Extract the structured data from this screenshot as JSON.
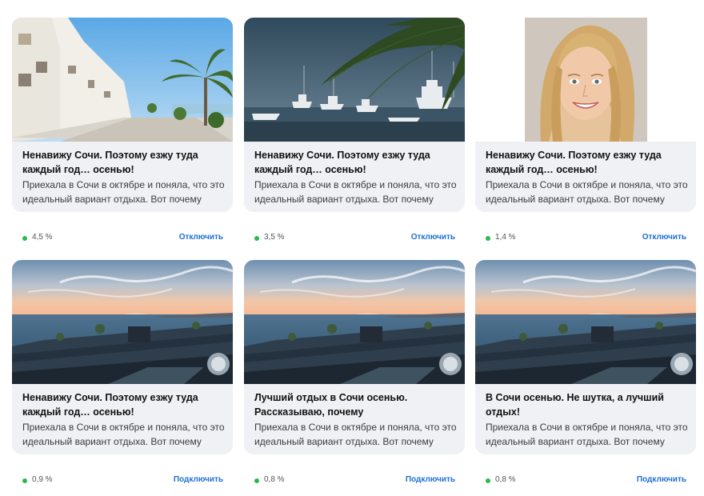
{
  "cards": [
    {
      "title": "Ненавижу Сочи. Поэтому езжу туда каждый год… осенью!",
      "description": "Приехала в Сочи в октябре и поняла, что это идеальный вариант отдыха. Вот почему",
      "ctr": "4,5 %",
      "toggle": "Отключить",
      "image": "seafront-promenade-palm"
    },
    {
      "title": "Ненавижу Сочи. Поэтому езжу туда каждый год… осенью!",
      "description": "Приехала в Сочи в октябре и поняла, что это идеальный вариант отдыха. Вот почему",
      "ctr": "3,5 %",
      "toggle": "Отключить",
      "image": "marina-yachts-palm"
    },
    {
      "title": "Ненавижу Сочи. Поэтому езжу туда каждый год… осенью!",
      "description": "Приехала в Сочи в октябре и поняла, что это идеальный вариант отдыха. Вот почему",
      "ctr": "1,4 %",
      "toggle": "Отключить",
      "image": "woman-portrait"
    },
    {
      "title": "Ненавижу Сочи. Поэтому езжу туда каждый год… осенью!",
      "description": "Приехала в Сочи в октябре и поняла, что это идеальный вариант отдыха. Вот почему",
      "ctr": "0,9 %",
      "toggle": "Подключить",
      "image": "sunset-sea-terrace"
    },
    {
      "title": "Лучший отдых в Сочи осенью. Рассказываю, почему",
      "description": "Приехала в Сочи в октябре и поняла, что это идеальный вариант отдыха. Вот почему",
      "ctr": "0,8 %",
      "toggle": "Подключить",
      "image": "sunset-sea-terrace"
    },
    {
      "title": "В Сочи осенью. Не шутка, а лучший отдых!",
      "description": "Приехала в Сочи в октябре и поняла, что это идеальный вариант отдыха. Вот почему",
      "ctr": "0,8 %",
      "toggle": "Подключить",
      "image": "sunset-sea-terrace"
    }
  ],
  "colors": {
    "status_dot": "#2db84b",
    "link": "#1f6fd1",
    "card_bg": "#f0f1f4"
  }
}
